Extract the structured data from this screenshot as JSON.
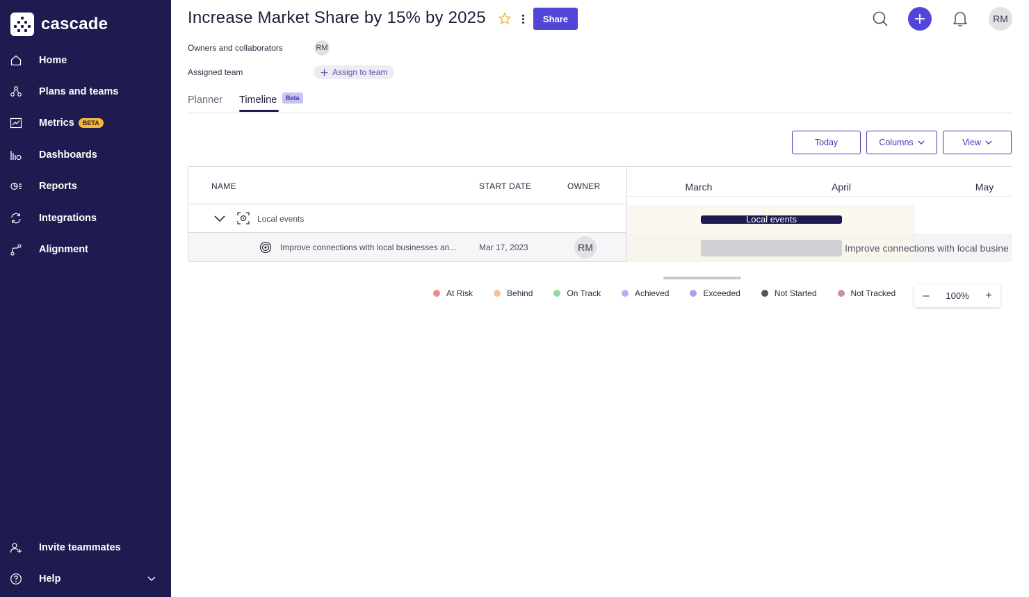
{
  "app": {
    "name": "cascade"
  },
  "sidebar": {
    "items": [
      {
        "label": "Home",
        "icon": "home-icon"
      },
      {
        "label": "Plans and teams",
        "icon": "plans-icon"
      },
      {
        "label": "Metrics",
        "icon": "metrics-icon",
        "badge": "BETA"
      },
      {
        "label": "Dashboards",
        "icon": "dashboards-icon"
      },
      {
        "label": "Reports",
        "icon": "reports-icon"
      },
      {
        "label": "Integrations",
        "icon": "integrations-icon"
      },
      {
        "label": "Alignment",
        "icon": "alignment-icon"
      }
    ],
    "bottom": [
      {
        "label": "Invite teammates",
        "icon": "invite-icon"
      },
      {
        "label": "Help",
        "icon": "help-icon"
      }
    ]
  },
  "header": {
    "title": "Increase Market Share by 15% by 2025",
    "share_label": "Share",
    "user_initials": "RM"
  },
  "meta": {
    "owners_label": "Owners and collaborators",
    "owner_initials": "RM",
    "team_label": "Assigned team",
    "assign_label": "Assign to team"
  },
  "tabs": [
    {
      "label": "Planner",
      "active": false
    },
    {
      "label": "Timeline",
      "active": true,
      "badge": "Beta"
    }
  ],
  "toolbar": {
    "today": "Today",
    "columns": "Columns",
    "view": "View"
  },
  "table": {
    "columns": [
      "NAME",
      "START DATE",
      "OWNER"
    ],
    "rows": [
      {
        "name": "Local events",
        "start_date": "",
        "owner": ""
      },
      {
        "name": "Improve connections with local businesses an...",
        "start_date": "Mar 17, 2023",
        "owner": "RM"
      }
    ]
  },
  "timeline": {
    "months": [
      "March",
      "April",
      "May"
    ],
    "group_bar_label": "Local events",
    "item_bar_label": "Improve connections with local busine"
  },
  "legend": [
    {
      "label": "At Risk",
      "color": "#ef8a8a"
    },
    {
      "label": "Behind",
      "color": "#f7c29a"
    },
    {
      "label": "On Track",
      "color": "#8fd9a0"
    },
    {
      "label": "Achieved",
      "color": "#b6aef0"
    },
    {
      "label": "Exceeded",
      "color": "#a9a2ef"
    },
    {
      "label": "Not Started",
      "color": "#555555"
    },
    {
      "label": "Not Tracked",
      "color": "#c98fa6"
    }
  ],
  "zoom": {
    "level": "100%",
    "minus": "–",
    "plus": "+"
  },
  "colors": {
    "sidebar": "#1f1a4f",
    "accent": "#5146d8",
    "star": "#f5b731"
  }
}
